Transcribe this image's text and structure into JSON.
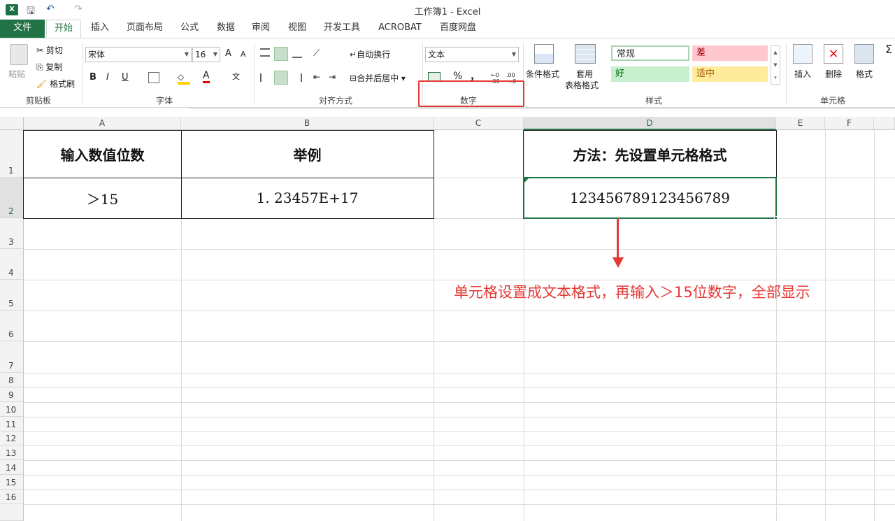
{
  "window": {
    "title": "工作簿1 - Excel"
  },
  "quick_access": {
    "save": "🖫",
    "undo": "↶",
    "redo": "↷"
  },
  "tabs": [
    "文件",
    "开始",
    "插入",
    "页面布局",
    "公式",
    "数据",
    "审阅",
    "视图",
    "开发工具",
    "ACROBAT",
    "百度网盘"
  ],
  "ribbon": {
    "clipboard": {
      "paste": "粘贴",
      "cut": "剪切",
      "copy": "复制",
      "format_painter": "格式刷",
      "label": "剪贴板"
    },
    "font": {
      "name": "宋体",
      "size": "16",
      "bold": "B",
      "italic": "I",
      "underline": "U",
      "label": "字体",
      "grow": "A",
      "shrink": "A",
      "phonetic": "文"
    },
    "alignment": {
      "wrap": "自动换行",
      "merge": "合并后居中",
      "label": "对齐方式"
    },
    "number": {
      "format": "文本",
      "percent": "%",
      "comma": "，",
      "label": "数字",
      "inc_dec": ".0\n.00",
      "dec_dec": ".00\n→.0"
    },
    "styles": {
      "cond_format": "条件格式",
      "table_format_1": "套用",
      "table_format_2": "表格格式",
      "normal": "常规",
      "bad": "差",
      "good": "好",
      "neutral": "适中",
      "label": "样式"
    },
    "cells": {
      "insert": "插入",
      "delete": "删除",
      "format": "格式",
      "label": "单元格"
    }
  },
  "sheet": {
    "columns": [
      "A",
      "B",
      "C",
      "D",
      "E",
      "F"
    ],
    "rows": [
      "1",
      "2",
      "3",
      "4",
      "5",
      "6",
      "7",
      "8",
      "9",
      "10",
      "11",
      "12",
      "13",
      "14",
      "15",
      "16"
    ],
    "cells": {
      "A1": "输入数值位数",
      "B1": "举例",
      "D1": "方法：先设置单元格格式",
      "A2": "＞15",
      "B2": "1. 23457E+17",
      "D2": "123456789123456789"
    }
  },
  "annotation": "单元格设置成文本格式，再输入＞15位数字，全部显示",
  "colors": {
    "excel_green": "#217346",
    "annotation_red": "#e53935"
  }
}
